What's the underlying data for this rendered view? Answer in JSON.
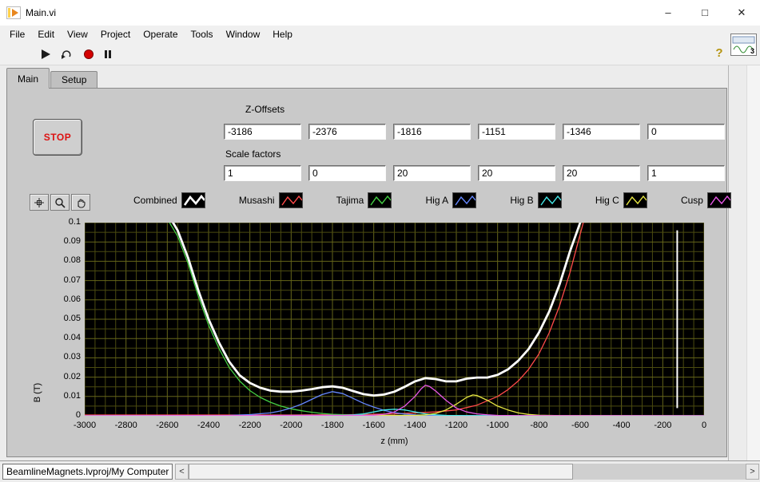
{
  "window": {
    "title": "Main.vi",
    "controls": {
      "minimize": "–",
      "maximize": "□",
      "close": "✕"
    }
  },
  "menu": {
    "items": [
      "File",
      "Edit",
      "View",
      "Project",
      "Operate",
      "Tools",
      "Window",
      "Help"
    ]
  },
  "toolbar": {
    "help_label": "?",
    "pane_badge": "3"
  },
  "tabs": {
    "items": [
      {
        "label": "Main",
        "active": true
      },
      {
        "label": "Setup",
        "active": false
      }
    ]
  },
  "panel": {
    "stop_button": "STOP",
    "z_offsets": {
      "label": "Z-Offsets",
      "values": [
        "-3186",
        "-2376",
        "-1816",
        "-1151",
        "-1346",
        "0"
      ]
    },
    "scale_factors": {
      "label": "Scale factors",
      "values": [
        "1",
        "0",
        "20",
        "20",
        "20",
        "1"
      ]
    }
  },
  "legend": {
    "items": [
      {
        "label": "Combined",
        "color": "#ffffff",
        "thick": true
      },
      {
        "label": "Musashi",
        "color": "#ff4a4a",
        "thick": false
      },
      {
        "label": "Tajima",
        "color": "#44d044",
        "thick": false
      },
      {
        "label": "Hig A",
        "color": "#6688ff",
        "thick": false
      },
      {
        "label": "Hig B",
        "color": "#44e8e8",
        "thick": false
      },
      {
        "label": "Hig C",
        "color": "#e8e844",
        "thick": false
      },
      {
        "label": "Cusp",
        "color": "#e858e8",
        "thick": false
      }
    ]
  },
  "chart_data": {
    "type": "line",
    "title": "",
    "xlabel": "z (mm)",
    "ylabel": "B (T)",
    "xlim": [
      -3000,
      0
    ],
    "ylim": [
      0,
      0.1
    ],
    "legend_position": "top",
    "x_tick_labels": [
      "-3000",
      "-2800",
      "-2600",
      "-2400",
      "-2200",
      "-2000",
      "-1800",
      "-1600",
      "-1400",
      "-1200",
      "-1000",
      "-800",
      "-600",
      "-400",
      "-200",
      "0"
    ],
    "y_tick_labels": [
      "0.1",
      "0.09",
      "0.08",
      "0.07",
      "0.06",
      "0.05",
      "0.04",
      "0.03",
      "0.02",
      "0.01",
      "0"
    ],
    "grid": {
      "minor_x": 50,
      "minor_y": 0.005,
      "minor_color": "#4b4b10",
      "major_color": "#66661a",
      "background": "#000000"
    },
    "series": [
      {
        "name": "musashi",
        "color": "#ff4a4a",
        "width": 1.3,
        "points": [
          [
            -3000,
            0.0004
          ],
          [
            -2000,
            0.0004
          ],
          [
            -1700,
            0.0006
          ],
          [
            -1500,
            0.001
          ],
          [
            -1300,
            0.002
          ],
          [
            -1200,
            0.003
          ],
          [
            -1100,
            0.0055
          ],
          [
            -1000,
            0.01
          ],
          [
            -950,
            0.0135
          ],
          [
            -900,
            0.018
          ],
          [
            -850,
            0.024
          ],
          [
            -800,
            0.032
          ],
          [
            -750,
            0.043
          ],
          [
            -700,
            0.057
          ],
          [
            -650,
            0.074
          ],
          [
            -600,
            0.094
          ],
          [
            -560,
            0.11
          ],
          [
            -480,
            0.128
          ],
          [
            -350,
            0.14
          ],
          [
            0,
            0.148
          ]
        ]
      },
      {
        "name": "tajima",
        "color": "#44d044",
        "width": 1.3,
        "points": [
          [
            -3000,
            0.112
          ],
          [
            -2650,
            0.109
          ],
          [
            -2600,
            0.102
          ],
          [
            -2550,
            0.093
          ],
          [
            -2500,
            0.079
          ],
          [
            -2450,
            0.062
          ],
          [
            -2400,
            0.047
          ],
          [
            -2350,
            0.035
          ],
          [
            -2300,
            0.025
          ],
          [
            -2250,
            0.018
          ],
          [
            -2200,
            0.013
          ],
          [
            -2150,
            0.0095
          ],
          [
            -2100,
            0.007
          ],
          [
            -2050,
            0.005
          ],
          [
            -2000,
            0.0036
          ],
          [
            -1950,
            0.0026
          ],
          [
            -1900,
            0.0018
          ],
          [
            -1850,
            0.0012
          ],
          [
            -1800,
            0.0008
          ],
          [
            -1700,
            0.0004
          ],
          [
            -1500,
            0.0002
          ],
          [
            -1000,
            0.0001
          ],
          [
            0,
            0.0001
          ]
        ]
      },
      {
        "name": "hig_a",
        "color": "#6688ff",
        "width": 1.3,
        "points": [
          [
            -3000,
            0
          ],
          [
            -2300,
            0.0002
          ],
          [
            -2200,
            0.0006
          ],
          [
            -2100,
            0.0015
          ],
          [
            -2050,
            0.0025
          ],
          [
            -2000,
            0.004
          ],
          [
            -1950,
            0.006
          ],
          [
            -1900,
            0.0085
          ],
          [
            -1850,
            0.011
          ],
          [
            -1800,
            0.0125
          ],
          [
            -1750,
            0.0115
          ],
          [
            -1700,
            0.009
          ],
          [
            -1650,
            0.0065
          ],
          [
            -1600,
            0.0045
          ],
          [
            -1550,
            0.0028
          ],
          [
            -1500,
            0.0016
          ],
          [
            -1450,
            0.0009
          ],
          [
            -1400,
            0.0005
          ],
          [
            -1300,
            0.0002
          ],
          [
            -1000,
            0
          ],
          [
            0,
            0
          ]
        ]
      },
      {
        "name": "hig_b",
        "color": "#44e8e8",
        "width": 1.3,
        "points": [
          [
            -3000,
            0
          ],
          [
            -1750,
            0.0002
          ],
          [
            -1700,
            0.0005
          ],
          [
            -1650,
            0.001
          ],
          [
            -1600,
            0.002
          ],
          [
            -1550,
            0.003
          ],
          [
            -1500,
            0.0034
          ],
          [
            -1450,
            0.003
          ],
          [
            -1400,
            0.002
          ],
          [
            -1350,
            0.001
          ],
          [
            -1300,
            0.0005
          ],
          [
            -1250,
            0.0002
          ],
          [
            -1100,
            0
          ],
          [
            0,
            0
          ]
        ]
      },
      {
        "name": "hig_c",
        "color": "#e8e844",
        "width": 1.3,
        "points": [
          [
            -3000,
            0
          ],
          [
            -1400,
            0.0002
          ],
          [
            -1350,
            0.0005
          ],
          [
            -1300,
            0.0012
          ],
          [
            -1250,
            0.003
          ],
          [
            -1200,
            0.006
          ],
          [
            -1150,
            0.0095
          ],
          [
            -1120,
            0.0108
          ],
          [
            -1100,
            0.0105
          ],
          [
            -1050,
            0.008
          ],
          [
            -1000,
            0.005
          ],
          [
            -950,
            0.003
          ],
          [
            -900,
            0.0015
          ],
          [
            -850,
            0.0007
          ],
          [
            -800,
            0.0003
          ],
          [
            -700,
            0.0001
          ],
          [
            0,
            0
          ]
        ]
      },
      {
        "name": "cusp",
        "color": "#e858e8",
        "width": 1.3,
        "points": [
          [
            -3000,
            0
          ],
          [
            -1600,
            0.0003
          ],
          [
            -1550,
            0.0008
          ],
          [
            -1500,
            0.002
          ],
          [
            -1450,
            0.005
          ],
          [
            -1400,
            0.01
          ],
          [
            -1370,
            0.014
          ],
          [
            -1350,
            0.0158
          ],
          [
            -1330,
            0.0152
          ],
          [
            -1300,
            0.0128
          ],
          [
            -1250,
            0.008
          ],
          [
            -1200,
            0.004
          ],
          [
            -1150,
            0.002
          ],
          [
            -1100,
            0.001
          ],
          [
            -1050,
            0.0005
          ],
          [
            -1000,
            0.0002
          ],
          [
            -900,
            0.0001
          ],
          [
            0,
            0
          ]
        ]
      },
      {
        "name": "combined",
        "color": "#ffffff",
        "width": 2.8,
        "points": [
          [
            -3000,
            0.115
          ],
          [
            -2650,
            0.112
          ],
          [
            -2600,
            0.105
          ],
          [
            -2550,
            0.096
          ],
          [
            -2500,
            0.082
          ],
          [
            -2450,
            0.065
          ],
          [
            -2400,
            0.05
          ],
          [
            -2350,
            0.038
          ],
          [
            -2300,
            0.028
          ],
          [
            -2250,
            0.021
          ],
          [
            -2200,
            0.017
          ],
          [
            -2150,
            0.0145
          ],
          [
            -2100,
            0.013
          ],
          [
            -2050,
            0.0125
          ],
          [
            -2000,
            0.0125
          ],
          [
            -1950,
            0.013
          ],
          [
            -1900,
            0.0138
          ],
          [
            -1850,
            0.0148
          ],
          [
            -1800,
            0.0152
          ],
          [
            -1750,
            0.0145
          ],
          [
            -1700,
            0.0128
          ],
          [
            -1650,
            0.0112
          ],
          [
            -1600,
            0.0105
          ],
          [
            -1550,
            0.011
          ],
          [
            -1500,
            0.0125
          ],
          [
            -1450,
            0.015
          ],
          [
            -1400,
            0.0178
          ],
          [
            -1350,
            0.0195
          ],
          [
            -1300,
            0.019
          ],
          [
            -1250,
            0.0178
          ],
          [
            -1200,
            0.0178
          ],
          [
            -1150,
            0.0192
          ],
          [
            -1100,
            0.0198
          ],
          [
            -1050,
            0.0198
          ],
          [
            -1000,
            0.0212
          ],
          [
            -950,
            0.024
          ],
          [
            -900,
            0.0285
          ],
          [
            -850,
            0.0345
          ],
          [
            -800,
            0.043
          ],
          [
            -750,
            0.054
          ],
          [
            -700,
            0.068
          ],
          [
            -650,
            0.085
          ],
          [
            -600,
            0.1
          ],
          [
            -550,
            0.118
          ],
          [
            -450,
            0.135
          ],
          [
            -300,
            0.145
          ],
          [
            0,
            0.15
          ]
        ]
      }
    ],
    "annotations": [
      {
        "type": "vline",
        "x": -130,
        "y1": 0.004,
        "y2": 0.096,
        "color": "#ffffff",
        "width": 2
      }
    ]
  },
  "statusbar": {
    "text": "BeamlineMagnets.lvproj/My Computer",
    "left_arrow": "<",
    "right_arrow": ">"
  }
}
